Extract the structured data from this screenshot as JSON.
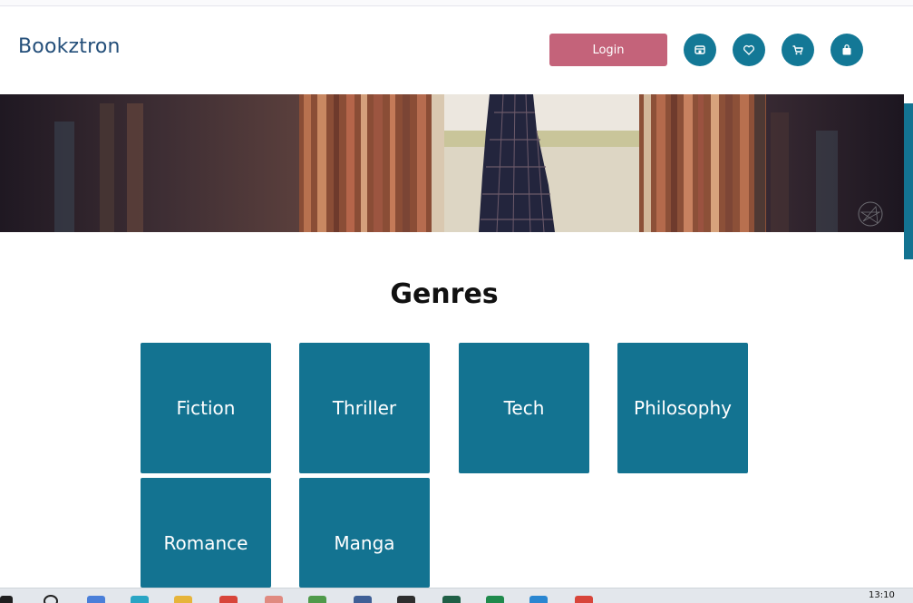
{
  "brand": {
    "name": "Bookztron"
  },
  "header": {
    "login_label": "Login",
    "icons": [
      "store-icon",
      "heart-icon",
      "cart-icon",
      "bag-icon"
    ]
  },
  "main": {
    "heading": "Genres",
    "genres": [
      {
        "label": "Fiction"
      },
      {
        "label": "Thriller"
      },
      {
        "label": "Tech"
      },
      {
        "label": "Philosophy"
      },
      {
        "label": "Romance"
      },
      {
        "label": "Manga"
      }
    ]
  },
  "taskbar": {
    "clock": "13:10"
  },
  "colors": {
    "brand": "#244f7a",
    "accent": "#137391",
    "login": "#c4637a"
  }
}
